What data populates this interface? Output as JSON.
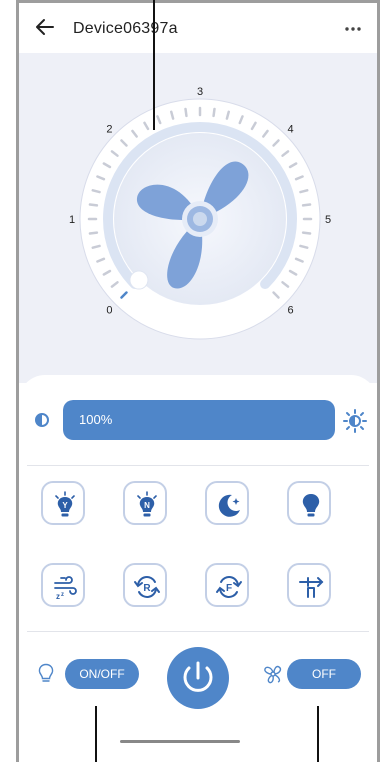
{
  "header": {
    "title": "Device06397a",
    "back_icon": "arrow-left-icon",
    "more_icon": "more-horizontal-icon"
  },
  "dial": {
    "labels": [
      "0",
      "1",
      "2",
      "3",
      "4",
      "5",
      "6"
    ],
    "fan_icon": "fan-icon"
  },
  "brightness": {
    "value_text": "100%",
    "level": 1.0,
    "dim_icon": "brightness-low-icon",
    "max_icon": "brightness-high-icon"
  },
  "modes": {
    "row1": [
      {
        "name": "light-yellow-button",
        "icon": "bulb-y-icon",
        "letter": "Y"
      },
      {
        "name": "light-neutral-button",
        "icon": "bulb-n-icon",
        "letter": "N"
      },
      {
        "name": "night-mode-button",
        "icon": "moon-icon"
      },
      {
        "name": "light-bulb-button",
        "icon": "bulb-icon"
      }
    ],
    "row2": [
      {
        "name": "breeze-mode-button",
        "icon": "wind-sleep-icon"
      },
      {
        "name": "reverse-button",
        "icon": "rotate-r-icon",
        "letter": "R"
      },
      {
        "name": "forward-button",
        "icon": "rotate-f-icon",
        "letter": "F"
      },
      {
        "name": "swing-button",
        "icon": "swing-icon"
      }
    ]
  },
  "bottom": {
    "light_toggle": "ON/OFF",
    "fan_toggle": "OFF",
    "power_icon": "power-icon",
    "bulb_icon": "bulb-outline-icon",
    "fan_icon": "fan-outline-icon"
  },
  "colors": {
    "accent": "#4f86c9",
    "dial_bg": "#eef0f7",
    "fan_blue": "#7ea2d8"
  }
}
